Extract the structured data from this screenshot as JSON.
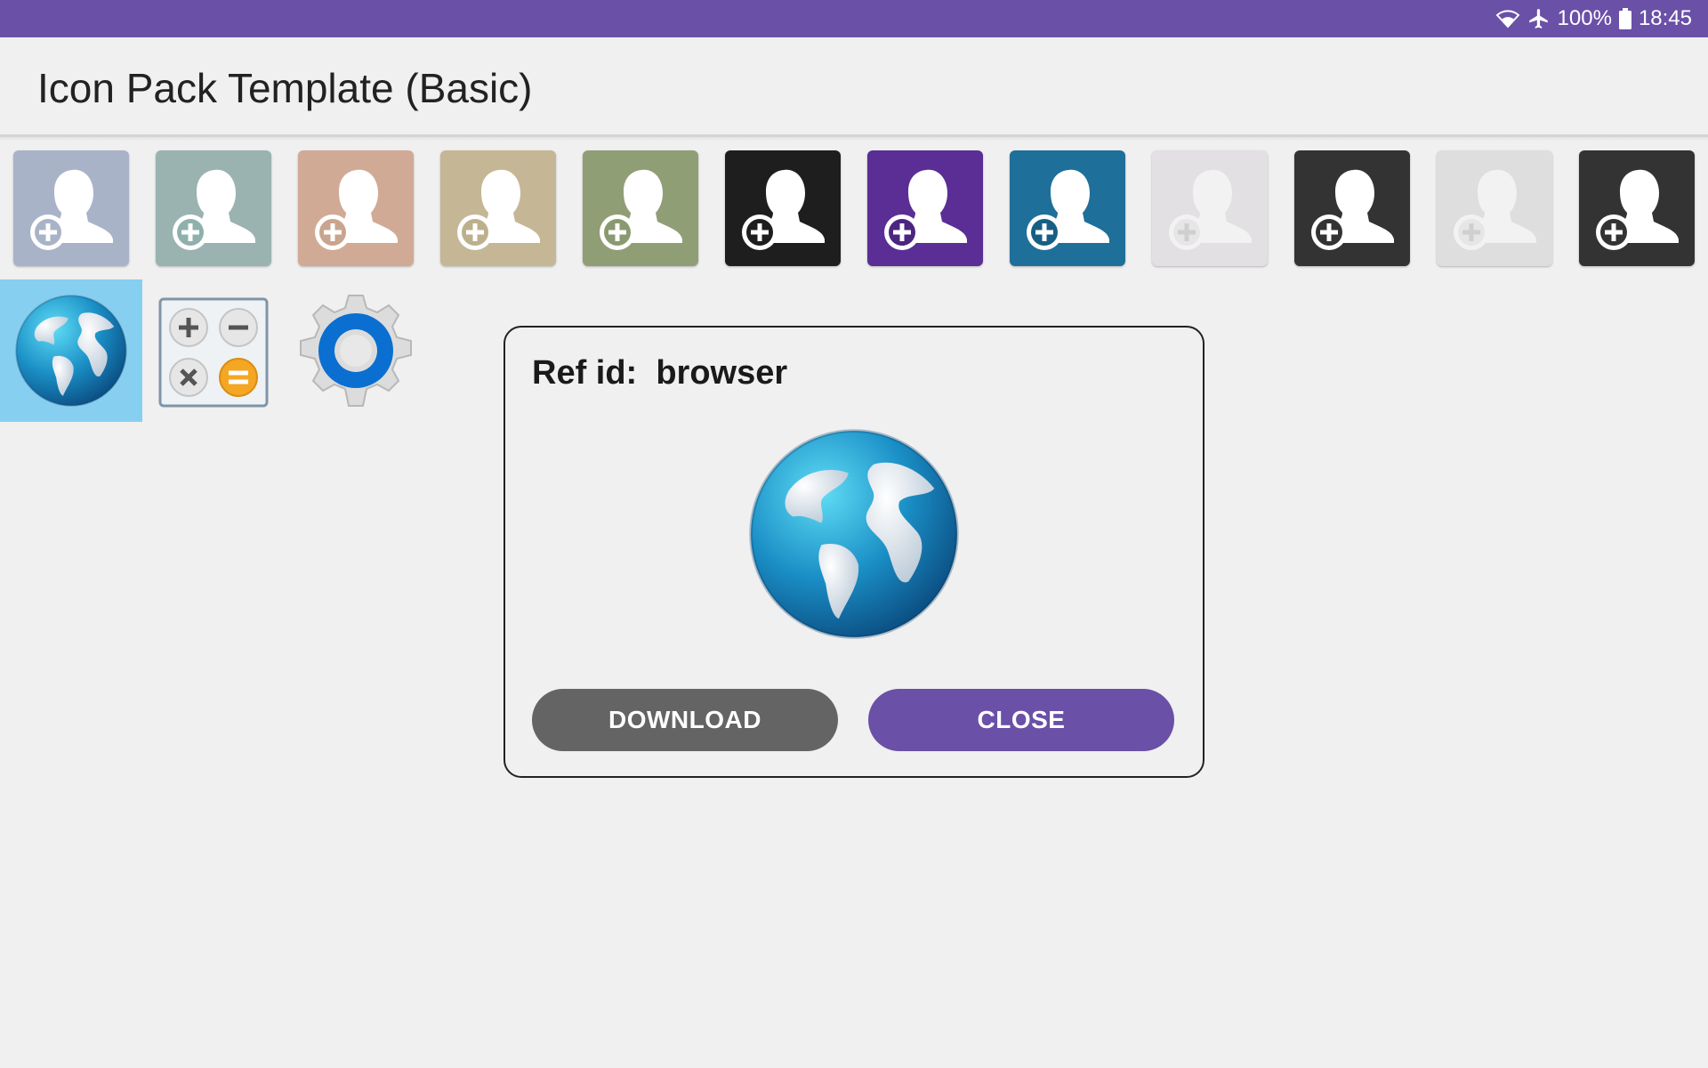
{
  "status_bar": {
    "battery": "100%",
    "time": "18:45",
    "icons": [
      "wifi-icon",
      "airplane-mode-icon",
      "battery-icon"
    ],
    "color": "#6a50a7"
  },
  "app_bar": {
    "title": "Icon Pack Template (Basic)"
  },
  "icons_row1": [
    {
      "name": "add-contact-icon",
      "bg": "#a9b3c8",
      "plus": "#a9b3c8"
    },
    {
      "name": "add-contact-icon",
      "bg": "#9ab3b0",
      "plus": "#8fb0ac"
    },
    {
      "name": "add-contact-icon",
      "bg": "#d1aa95",
      "plus": "#c9a48e"
    },
    {
      "name": "add-contact-icon",
      "bg": "#c5b795",
      "plus": "#bdb08d"
    },
    {
      "name": "add-contact-icon",
      "bg": "#909e76",
      "plus": "#8a9a70"
    },
    {
      "name": "add-contact-icon",
      "bg": "#1e1e1e",
      "plus": "#1e1e1e"
    },
    {
      "name": "add-contact-icon",
      "bg": "#5a2e94",
      "plus": "#4b2580"
    },
    {
      "name": "add-contact-icon",
      "bg": "#1e6f9a",
      "plus": "#175e85"
    },
    {
      "name": "add-contact-icon",
      "bg": "#e2e0e2",
      "plus": "#e0dde0"
    },
    {
      "name": "add-contact-icon",
      "bg": "#333333",
      "plus": "#333333"
    },
    {
      "name": "add-contact-icon",
      "bg": "#dedede",
      "plus": "#dcdcdc"
    },
    {
      "name": "add-contact-icon",
      "bg": "#333333",
      "plus": "#333333"
    }
  ],
  "icons_row2": [
    "browser-globe-icon",
    "calculator-icon",
    "settings-gear-icon"
  ],
  "dialog": {
    "title": "Ref id:  browser",
    "icon": "browser-globe-icon",
    "download_label": "DOWNLOAD",
    "close_label": "CLOSE",
    "download_color": "#646464",
    "close_color": "#6a50a7"
  }
}
